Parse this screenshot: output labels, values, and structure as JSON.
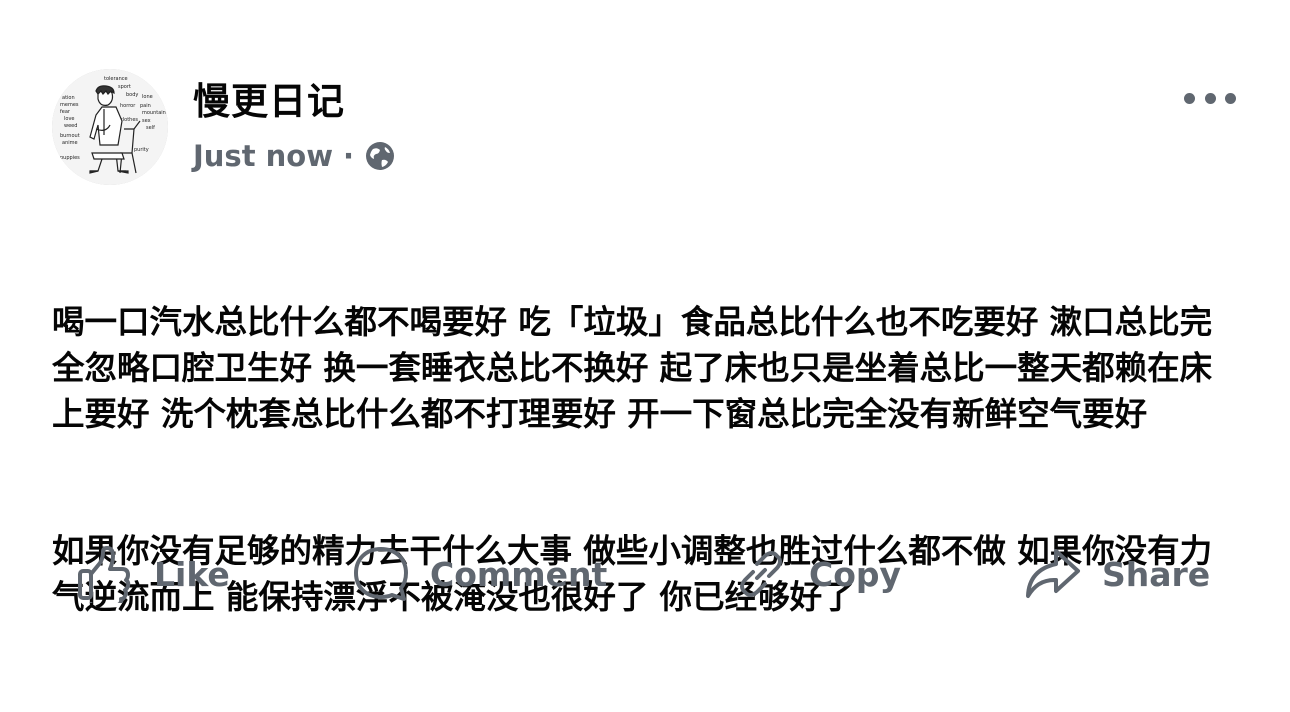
{
  "post": {
    "author": "慢更日记",
    "timestamp": "Just now",
    "separator": "·",
    "privacy_icon": "globe-icon",
    "more_icon": "more-dots-icon",
    "avatar_words": [
      "tolerance",
      "sport",
      "body",
      "lone",
      "horror",
      "pain",
      "mountain",
      "clothes",
      "sex",
      "self",
      "fear",
      "purity",
      "ation",
      "memes",
      "love",
      "weed",
      "burnout",
      "anime",
      "puppies"
    ],
    "paragraphs": [
      "喝一口汽水总比什么都不喝要好 吃「垃圾」食品总比什么也不吃要好 漱口总比完全忽略口腔卫生好 换一套睡衣总比不换好 起了床也只是坐着总比一整天都赖在床上要好 洗个枕套总比什么都不打理要好 开一下窗总比完全没有新鲜空气要好",
      "如果你没有足够的精力去干什么大事 做些小调整也胜过什么都不做 如果你没有力气逆流而上 能保持漂浮不被淹没也很好了 你已经够好了"
    ]
  },
  "actions": {
    "like": {
      "label": "Like",
      "icon": "thumbs-up-icon"
    },
    "comment": {
      "label": "Comment",
      "icon": "comment-bubble-icon"
    },
    "copy": {
      "label": "Copy",
      "icon": "link-icon"
    },
    "share": {
      "label": "Share",
      "icon": "share-arrow-icon"
    }
  },
  "colors": {
    "text": "#050505",
    "secondary": "#606770",
    "background": "#ffffff"
  }
}
